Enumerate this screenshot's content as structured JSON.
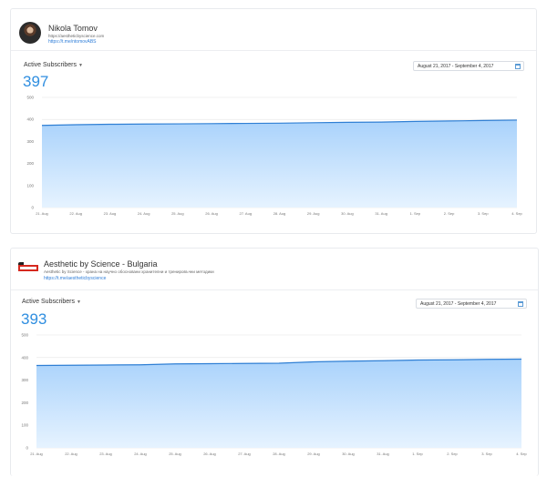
{
  "colors": {
    "accent": "#2f8ee0",
    "line": "#2f7fd4",
    "fill_top": "#a9d2fb",
    "fill_bottom": "#e6f3ff",
    "grid": "#e6e6e6"
  },
  "cards": [
    {
      "channel": {
        "name": "Nikola Tomov",
        "subtitle": "https://aestheticbyscience.com",
        "link": "https://t.me/ntomovABS",
        "avatar_icon": "profile-photo-icon"
      },
      "metric_label": "Active Subscribers",
      "big_number": "397",
      "date_range": "August 21, 2017 - September 4, 2017",
      "chart_data": {
        "type": "area",
        "x": [
          "21. Aug",
          "22. Aug",
          "23. Aug",
          "24. Aug",
          "25. Aug",
          "26. Aug",
          "27. Aug",
          "28. Aug",
          "29. Aug",
          "30. Aug",
          "31. Aug",
          "1. Sep",
          "2. Sep",
          "3. Sep",
          "4. Sep"
        ],
        "series": [
          {
            "values": [
              373,
              376,
              378,
              379,
              380,
              381,
              382,
              383,
              385,
              387,
              388,
              391,
              393,
              395,
              397
            ]
          }
        ],
        "yticks": [
          0,
          100,
          200,
          300,
          400,
          500
        ],
        "ylim": [
          0,
          500
        ],
        "grid": true
      }
    },
    {
      "channel": {
        "name": "Aesthetic by Science - Bulgaria",
        "subtitle": "Aesthetic by Science - храна на научно обосновани хранителни и тренировъчни методики",
        "link": "https://t.me/aestheticbyscience",
        "avatar_icon": "aesthetic-logo-icon"
      },
      "metric_label": "Active Subscribers",
      "big_number": "393",
      "date_range": "August 21, 2017 - September 4, 2017",
      "chart_data": {
        "type": "area",
        "x": [
          "21. Aug",
          "22. Aug",
          "23. Aug",
          "24. Aug",
          "25. Aug",
          "26. Aug",
          "27. Aug",
          "28. Aug",
          "29. Aug",
          "30. Aug",
          "31. Aug",
          "1. Sep",
          "2. Sep",
          "3. Sep",
          "4. Sep"
        ],
        "series": [
          {
            "values": [
              365,
              366,
              367,
              368,
              372,
              373,
              374,
              375,
              381,
              384,
              386,
              389,
              390,
              392,
              393
            ]
          }
        ],
        "yticks": [
          0,
          100,
          200,
          300,
          400,
          500
        ],
        "ylim": [
          0,
          500
        ],
        "grid": true
      }
    }
  ]
}
